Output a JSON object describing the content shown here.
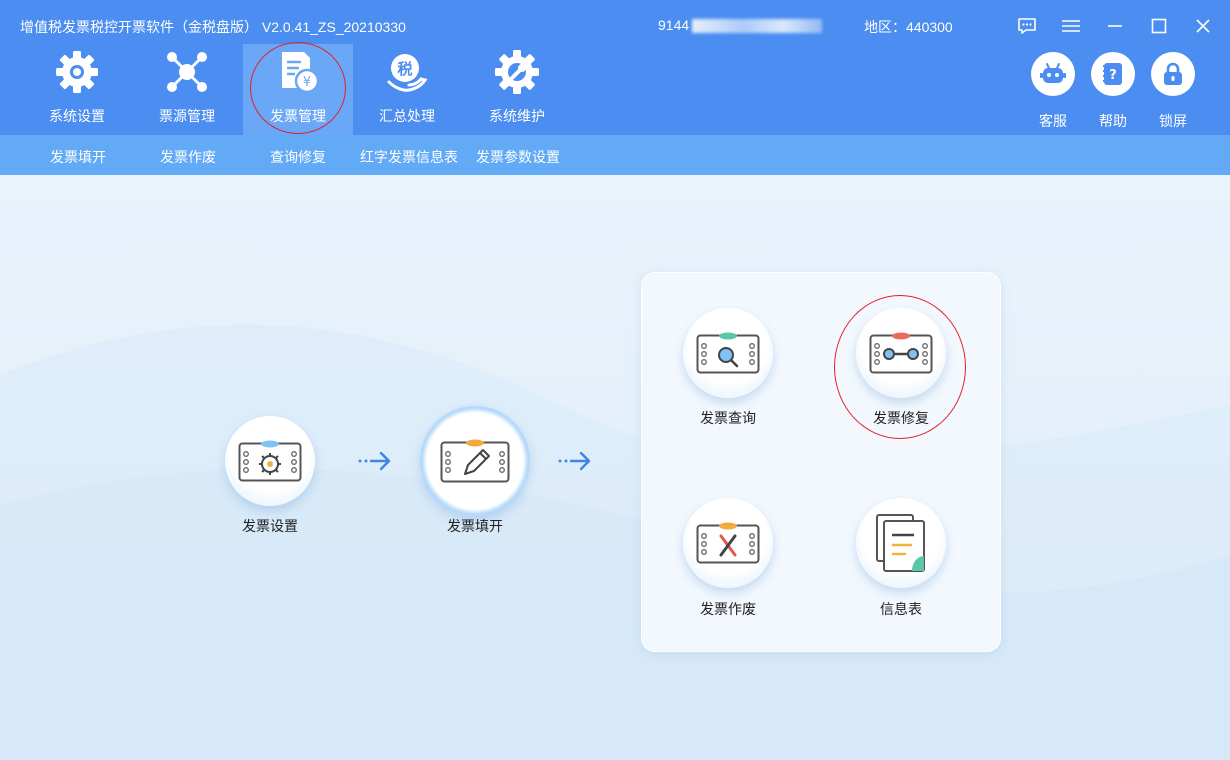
{
  "titlebar": {
    "app_title": "增值税发票税控开票软件（金税盘版） V2.0.41_ZS_20210330",
    "taxid_prefix": "9144",
    "region": "地区：440300"
  },
  "nav": {
    "tabs": [
      {
        "label": "系统设置",
        "icon": "gear-icon"
      },
      {
        "label": "票源管理",
        "icon": "network-icon"
      },
      {
        "label": "发票管理",
        "icon": "invoice-yen-icon",
        "active": true
      },
      {
        "label": "汇总处理",
        "icon": "tax-summary-icon"
      },
      {
        "label": "系统维护",
        "icon": "wrench-gear-icon"
      }
    ],
    "right": [
      {
        "label": "客服",
        "icon": "robot-icon"
      },
      {
        "label": "帮助",
        "icon": "help-book-icon"
      },
      {
        "label": "锁屏",
        "icon": "lock-icon"
      }
    ]
  },
  "submenu": [
    "发票填开",
    "发票作废",
    "查询修复",
    "红字发票信息表",
    "发票参数设置"
  ],
  "flow": {
    "settings": "发票设置",
    "issue": "发票填开"
  },
  "panel": {
    "query": "发票查询",
    "repair": "发票修复",
    "void": "发票作废",
    "info": "信息表"
  },
  "colors": {
    "header": "#4b8df0",
    "submenu": "#62aaf6",
    "accent_red": "#e3202a"
  }
}
